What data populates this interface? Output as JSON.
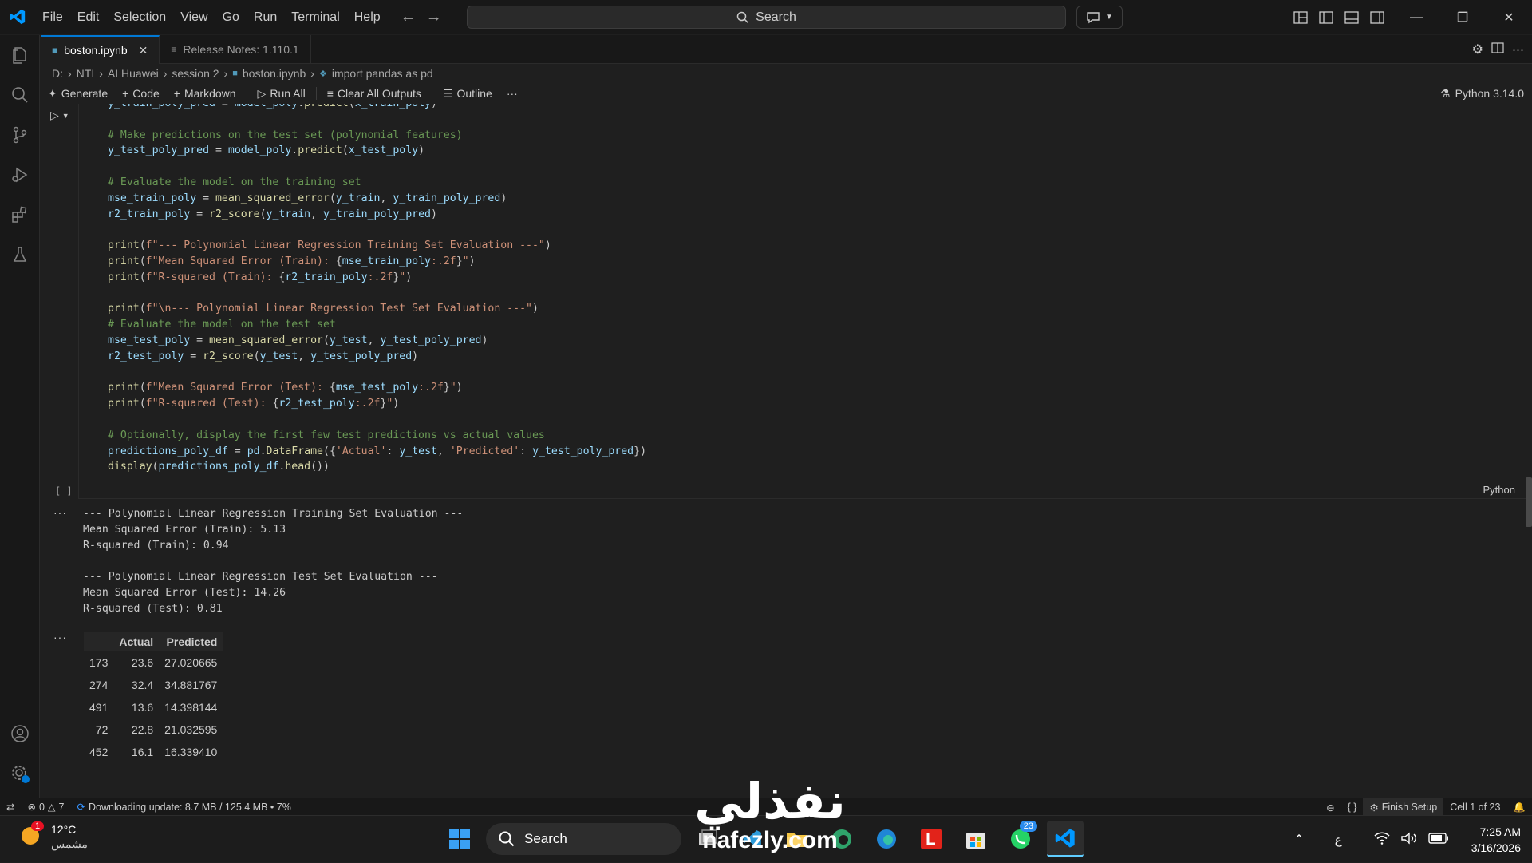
{
  "titlebar": {
    "menu": [
      "File",
      "Edit",
      "Selection",
      "View",
      "Go",
      "Run",
      "Terminal",
      "Help"
    ],
    "search_label": "Search"
  },
  "tabs": [
    {
      "label": "boston.ipynb",
      "active": true
    },
    {
      "label": "Release Notes: 1.110.1",
      "active": false
    }
  ],
  "breadcrumb": [
    "D:",
    "NTI",
    "AI Huawei",
    "session 2",
    "boston.ipynb",
    "import pandas as pd"
  ],
  "nb_toolbar": {
    "generate": "Generate",
    "code": "Code",
    "markdown": "Markdown",
    "run_all": "Run All",
    "clear_outputs": "Clear All Outputs",
    "outline": "Outline",
    "more": "···",
    "kernel": "Python 3.14.0"
  },
  "cell": {
    "exec_count": "[ ]",
    "language": "Python"
  },
  "output": {
    "more_1": "···",
    "more_2": "···",
    "train_header": "--- Polynomial Linear Regression Training Set Evaluation ---",
    "train_mse": "Mean Squared Error (Train): 5.13",
    "train_r2": "R-squared (Train): 0.94",
    "test_header": "--- Polynomial Linear Regression Test Set Evaluation ---",
    "test_mse": "Mean Squared Error (Test): 14.26",
    "test_r2": "R-squared (Test): 0.81",
    "table": {
      "columns": [
        "",
        "Actual",
        "Predicted"
      ],
      "rows": [
        [
          "173",
          "23.6",
          "27.020665"
        ],
        [
          "274",
          "32.4",
          "34.881767"
        ],
        [
          "491",
          "13.6",
          "14.398144"
        ],
        [
          "72",
          "22.8",
          "21.032595"
        ],
        [
          "452",
          "16.1",
          "16.339410"
        ]
      ]
    }
  },
  "statusbar": {
    "errors": "0",
    "warnings": "7",
    "update": "Downloading update: 8.7 MB / 125.4 MB • 7%",
    "braces": "{ }",
    "finish_setup": "Finish Setup",
    "cell_pos": "Cell 1 of 23"
  },
  "taskbar": {
    "temp": "12°C",
    "weather_desc": "مشمس",
    "weather_badge": "1",
    "search": "Search",
    "whatsapp_badge": "23",
    "lang": "ع",
    "time": "7:25 AM",
    "date": "3/16/2026"
  },
  "watermark": {
    "arabic": "نفذلي",
    "latin": "nafezly.com"
  },
  "colors": {
    "accent": "#0078d4",
    "comment": "#6a9955",
    "function": "#dcdcaa",
    "string": "#ce9178",
    "variable": "#9cdcfe"
  }
}
